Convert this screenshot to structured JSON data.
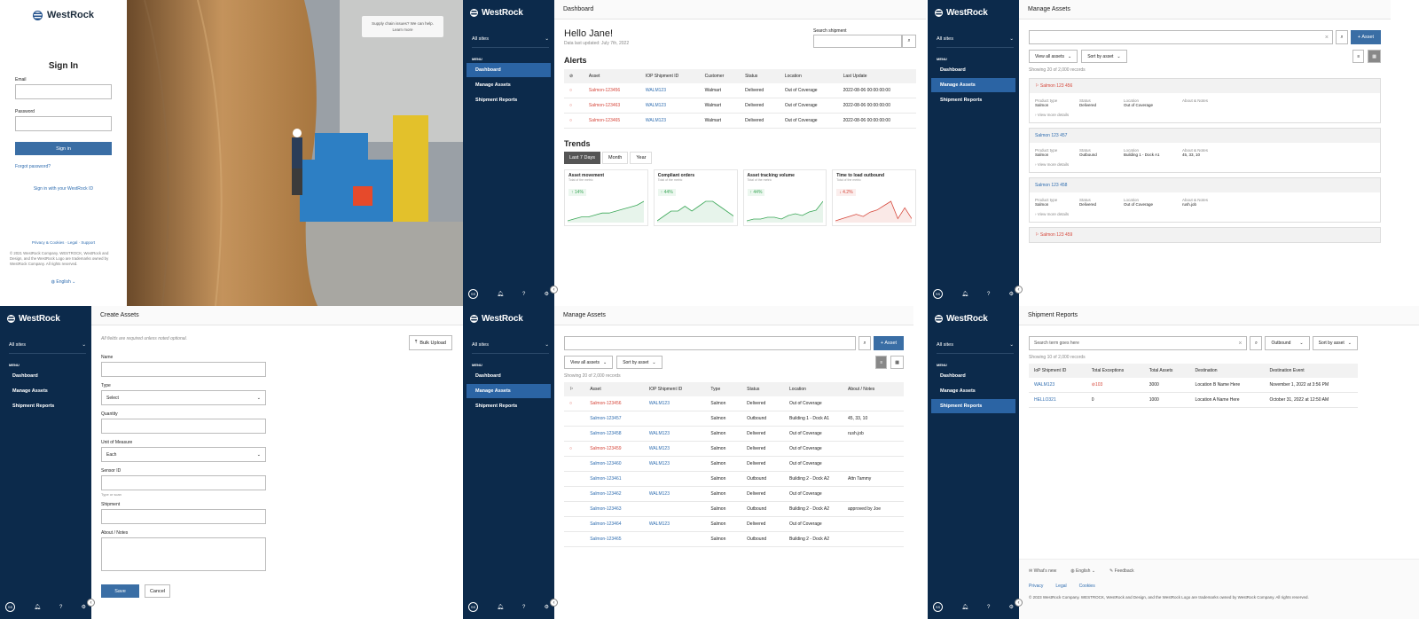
{
  "signin": {
    "brand": "WestRock",
    "tooltip_line1": "Supply chain issues? We can help.",
    "tooltip_line2": "Learn more",
    "title": "Sign In",
    "email_label": "Email",
    "password_label": "Password",
    "button": "Sign in",
    "forgot": "Forgot password?",
    "sso": "Sign in with your WestRock ID",
    "links": [
      "Privacy & Cookies",
      "Legal",
      "Support"
    ],
    "copyright": "© 2021 WestRock Company. WESTROCK, WestRock and Design, and the WestRock Logo are trademarks owned by WestRock Company. All rights reserved.",
    "language": "English"
  },
  "sidebar": {
    "brand": "WestRock",
    "sites": "All sites",
    "menu_heading": "MENU",
    "items": [
      "Dashboard",
      "Manage Assets",
      "Shipment Reports"
    ],
    "avatar": "SS"
  },
  "dashboard": {
    "topbar": "Dashboard",
    "greeting": "Hello Jane!",
    "updated": "Data last updated: July 7th, 2022",
    "search_label": "Search shipment",
    "alerts_title": "Alerts",
    "alert_headers": [
      "",
      "Asset",
      "IOP Shipment ID",
      "Customer",
      "Status",
      "Location",
      "Last Update"
    ],
    "alerts": [
      {
        "asset": "Salmon-123456",
        "iop": "WALM123",
        "customer": "Walmart",
        "status": "Delivered",
        "location": "Out of Coverage",
        "update": "2022-08-06 00:00:00:00"
      },
      {
        "asset": "Salmon-123463",
        "iop": "WALM123",
        "customer": "Walmart",
        "status": "Delivered",
        "location": "Out of Coverage",
        "update": "2022-08-06 00:00:00:00"
      },
      {
        "asset": "Salmon-123465",
        "iop": "WALM123",
        "customer": "Walmart",
        "status": "Delivered",
        "location": "Out of Coverage",
        "update": "2022-08-06 00:00:00:00"
      }
    ],
    "trends_title": "Trends",
    "tabs": [
      "Last 7 Days",
      "Month",
      "Year"
    ],
    "trend_cards": [
      {
        "title": "Asset movement",
        "sub": "Total of the metric",
        "delta": "↑ 14%",
        "color": "#3aa757",
        "points": [
          2,
          3,
          4,
          4,
          5,
          6,
          6,
          7,
          8,
          9,
          10,
          12
        ]
      },
      {
        "title": "Compliant orders",
        "sub": "Total of the metric",
        "delta": "↑ 44%",
        "color": "#3aa757",
        "points": [
          8,
          9,
          10,
          10,
          11,
          10,
          11,
          12,
          12,
          11,
          10,
          9
        ]
      },
      {
        "title": "Asset tracking volume",
        "sub": "Total of the metric",
        "delta": "↑ 44%",
        "color": "#3aa757",
        "points": [
          1,
          2,
          2,
          3,
          3,
          2,
          4,
          5,
          4,
          6,
          7,
          12
        ]
      },
      {
        "title": "Time to load outbound",
        "sub": "Total of the metric",
        "delta": "↓ 4.2%",
        "color": "#d6473b",
        "points": [
          3,
          4,
          5,
          6,
          5,
          7,
          8,
          10,
          12,
          4,
          9,
          4
        ]
      }
    ]
  },
  "manage_cards": {
    "topbar": "Manage Assets",
    "add": "+ Asset",
    "filter": "View all assets",
    "sort": "Sort by asset",
    "count": "Showing 20 of 2,000 records",
    "more": "View more details",
    "cards": [
      {
        "name": "Salmon 123 456",
        "alert": true,
        "fields": [
          [
            "Product type",
            "Salmon"
          ],
          [
            "Status",
            "Delivered"
          ],
          [
            "Location",
            "Out of Coverage"
          ],
          [
            "About & Notes",
            ""
          ]
        ]
      },
      {
        "name": "Salmon 123 457",
        "alert": false,
        "fields": [
          [
            "Product type",
            "Salmon"
          ],
          [
            "Status",
            "Outbound"
          ],
          [
            "Location",
            "Building 1 - Dock A1"
          ],
          [
            "About & Notes",
            "45, 33, 10"
          ]
        ]
      },
      {
        "name": "Salmon 123 458",
        "alert": false,
        "fields": [
          [
            "Product type",
            "Salmon"
          ],
          [
            "Status",
            "Delivered"
          ],
          [
            "Location",
            "Out of Coverage"
          ],
          [
            "About & Notes",
            "rush.job"
          ]
        ]
      },
      {
        "name": "Salmon 123 459",
        "alert": true,
        "fields": []
      }
    ]
  },
  "create": {
    "topbar": "Create Assets",
    "note": "All fields are required unless noted optional.",
    "bulk": "Bulk Upload",
    "name": "Name",
    "type": "Type",
    "type_value": "Select",
    "quantity": "Quantity",
    "uom": "Unit of Measure",
    "uom_value": "Each",
    "sensor": "Sensor ID",
    "sensor_hint": "Type or scan",
    "shipment": "Shipment",
    "notes": "About / Notes",
    "save": "Save",
    "cancel": "Cancel"
  },
  "manage_table": {
    "topbar": "Manage Assets",
    "add": "+ Asset",
    "filter": "View all assets",
    "sort": "Sort by asset",
    "count": "Showing 20 of 2,000 records",
    "headers": [
      "",
      "Asset",
      "IOP Shipment ID",
      "Type",
      "Status",
      "Location",
      "About / Notes"
    ],
    "rows": [
      {
        "alert": true,
        "asset": "Salmon-123456",
        "iop": "WALM123",
        "type": "Salmon",
        "status": "Delivered",
        "location": "Out of Coverage",
        "notes": ""
      },
      {
        "alert": false,
        "asset": "Salmon-123457",
        "iop": "",
        "type": "Salmon",
        "status": "Outbound",
        "location": "Building 1 - Dock A1",
        "notes": "45, 33, 10"
      },
      {
        "alert": false,
        "asset": "Salmon-123458",
        "iop": "WALM123",
        "type": "Salmon",
        "status": "Delivered",
        "location": "Out of Coverage",
        "notes": "rush.job"
      },
      {
        "alert": true,
        "asset": "Salmon-123459",
        "iop": "WALM123",
        "type": "Salmon",
        "status": "Delivered",
        "location": "Out of Coverage",
        "notes": ""
      },
      {
        "alert": false,
        "asset": "Salmon-123460",
        "iop": "WALM123",
        "type": "Salmon",
        "status": "Delivered",
        "location": "Out of Coverage",
        "notes": ""
      },
      {
        "alert": false,
        "asset": "Salmon-123461",
        "iop": "",
        "type": "Salmon",
        "status": "Outbound",
        "location": "Building 2 - Dock A2",
        "notes": "Attn Tammy"
      },
      {
        "alert": false,
        "asset": "Salmon-123462",
        "iop": "WALM123",
        "type": "Salmon",
        "status": "Delivered",
        "location": "Out of Coverage",
        "notes": ""
      },
      {
        "alert": false,
        "asset": "Salmon-123463",
        "iop": "",
        "type": "Salmon",
        "status": "Outbound",
        "location": "Building 2 - Dock A2",
        "notes": "approved by Joe"
      },
      {
        "alert": false,
        "asset": "Salmon-123464",
        "iop": "WALM123",
        "type": "Salmon",
        "status": "Delivered",
        "location": "Out of Coverage",
        "notes": ""
      },
      {
        "alert": false,
        "asset": "Salmon-123465",
        "iop": "",
        "type": "Salmon",
        "status": "Outbound",
        "location": "Building 2 - Dock A2",
        "notes": ""
      }
    ]
  },
  "reports": {
    "topbar": "Shipment Reports",
    "search_placeholder": "Search term goes here",
    "filter": "Outbound",
    "sort": "Sort by asset",
    "count": "Showing 10 of 2,000 records",
    "headers": [
      "IoP Shipment ID",
      "Total Exceptions",
      "Total Assets",
      "Destination",
      "Destination Event"
    ],
    "rows": [
      {
        "id": "WALM123",
        "exceptions": "103",
        "assets": "3000",
        "dest": "Location B Name Here",
        "event": "November 1, 2022 at 3:56 PM"
      },
      {
        "id": "HELLO321",
        "exceptions": "0",
        "assets": "1000",
        "dest": "Location A Name Here",
        "event": "October 31, 2022 at 12:50 AM"
      }
    ],
    "footer_links": [
      "What's new",
      "English",
      "Feedback"
    ],
    "footer_links2": [
      "Privacy",
      "Legal",
      "Cookies"
    ],
    "copyright": "© 2023 WestRock Company. WESTROCK, WestRock and Design, and the WestRock Logo are trademarks owned by WestRock Company. All rights reserved."
  }
}
